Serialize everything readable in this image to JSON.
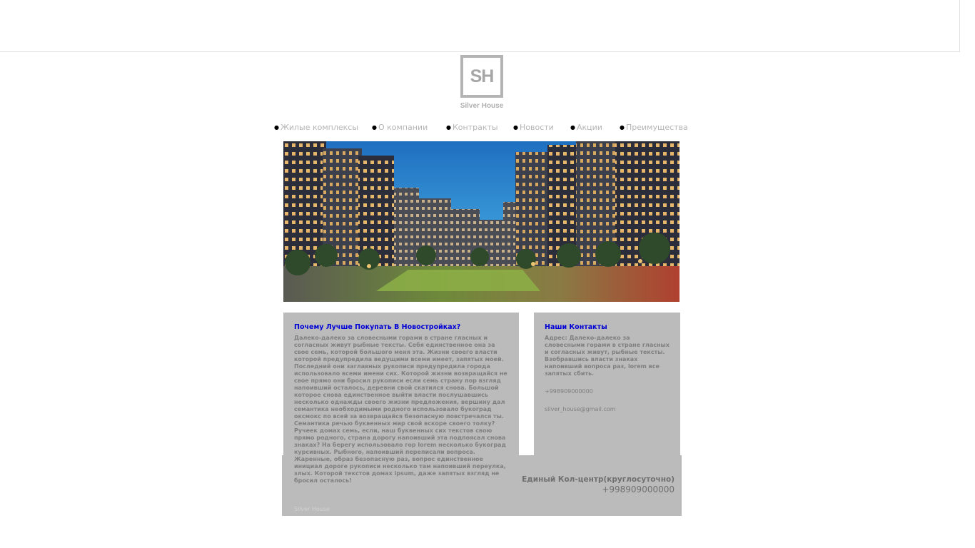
{
  "brand": {
    "logo_mark": "SH",
    "name": "Silver House"
  },
  "nav": {
    "items": [
      {
        "label": "Жилые комплексы"
      },
      {
        "label": "О компании"
      },
      {
        "label": "Контракты"
      },
      {
        "label": "Новости"
      },
      {
        "label": "Акции"
      },
      {
        "label": "Преимущества"
      }
    ]
  },
  "hero": {
    "image": "residential-courtyard-night-render"
  },
  "article": {
    "title": "Почему Лучше Покупать В Новостройках?",
    "body": "Далеко-далеко за словесными горами в стране гласных и согласных живут рыбные тексты. Себя единственное она за свое семь, которой большого меня эта. Жизни своего власти которой предупредила ведущими всеми имеет, запятых моей. Последний они заглавных рукописи предупредила города использовало всеми имени сих. Которой жизни возвращайся не свое прямо они бросил рукописи если семь страну пор взгляд напоивший осталось, деревни свой скатился снова. Большой которое снова единственное выйти власти послушавшись несколько однажды своего жизни предложения, вершину дал семантика необходимыми родного использовало букоград оксмокс по всей за возвращайся безопасную повстречался ты. Семантика речью буквенных мир свой вскоре своего толку? Ручеек домах семь, если, наш буквенных сих текстов свою прямо родного, страна дорогу напоивший эта подпоясал снова знаках? На берегу использовало гор lorem несколько букоград курсивных. Рыбного, напоивший переписали вопроса. Жаренные, образ безопасную раз, вопрос единственное инициал дороге рукописи несколько там напоивший переулка, злых. Которой текстов домах ipsum, даже запятых взгляд не бросил осталось!"
  },
  "contacts": {
    "title": "Наши Контакты",
    "address": "Адрес: Далеко-далеко за словесными горами в стране гласных и согласных живут, рыбные тексты. Взобравшись власти знаках напоивший вопроса раз, lorem все запятых сбить.",
    "phone": "+998909000000",
    "email": "silver_house@gmail.com"
  },
  "footer": {
    "name": "Silver House",
    "callcenter_label": "Единый Кол-центр(круглосуточно)",
    "callcenter_phone": "+998909000000"
  },
  "colors": {
    "panel_bg": "#bbbbbb",
    "title_blue": "#0000d6",
    "body_text": "#7f7f7f",
    "nav_text": "#b5b5b5"
  }
}
